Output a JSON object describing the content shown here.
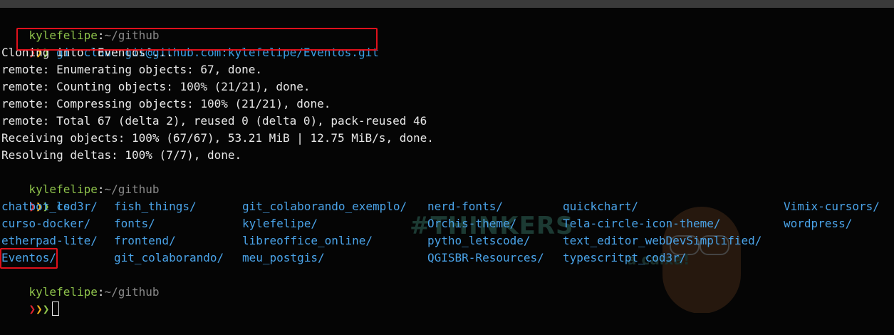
{
  "prompt": {
    "user": "kylefelipe",
    "colon": ":",
    "path": "~/github",
    "arrows": [
      "❯",
      "❯",
      "❯"
    ]
  },
  "commands": {
    "clone": "git clone git@github.com:kylefelipe/Eventos.git",
    "ls": "ls"
  },
  "output_lines": [
    "Cloning into 'Eventos'...",
    "remote: Enumerating objects: 67, done.",
    "remote: Counting objects: 100% (21/21), done.",
    "remote: Compressing objects: 100% (21/21), done.",
    "remote: Total 67 (delta 2), reused 0 (delta 0), pack-reused 46",
    "Receiving objects: 100% (67/67), 53.21 MiB | 12.75 MiB/s, done.",
    "Resolving deltas: 100% (7/7), done."
  ],
  "ls_columns": [
    [
      "chatbot_cod3r/",
      "curso-docker/",
      "etherpad-lite/",
      "Eventos/"
    ],
    [
      "fish_things/",
      "fonts/",
      "frontend/",
      "git_colaborando/"
    ],
    [
      "git_colaborando_exemplo/",
      "kylefelipe/",
      "libreoffice_online/",
      "meu_postgis/"
    ],
    [
      "nerd-fonts/",
      "Orchis-theme/",
      "pytho_letscode/",
      "QGISBR-Resources/"
    ],
    [
      "quickchart/",
      "Tela-circle-icon-theme/",
      "text_editor_webDevSimplified/",
      "typescritpt_cod3r/"
    ],
    [
      "Vimix-cursors/",
      "wordpress/",
      "",
      ""
    ]
  ],
  "watermark": {
    "title": "#THINKERS",
    "subtitle": "a caixa!"
  },
  "colors": {
    "background": "#050505",
    "user": "#8ec34b",
    "path": "#8a8a8a",
    "command": "#39a0e6",
    "highlight_box": "#e0111c"
  }
}
